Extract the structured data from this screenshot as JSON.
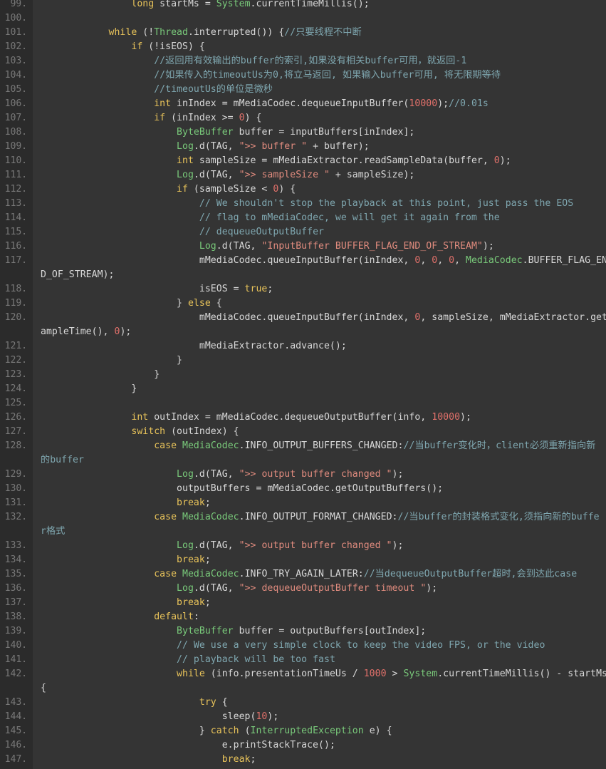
{
  "editor": {
    "name": "code-editor",
    "language": "Java",
    "wrap_enabled": true,
    "first_line": 99,
    "last_line": 147,
    "colors": {
      "background": "#343434",
      "gutter_background": "#2b2b2b",
      "line_number": "#787878",
      "plain": "#d8d8d8",
      "keyword": "#e8c35a",
      "type": "#79c97a",
      "string": "#e08b7e",
      "number": "#e0706a",
      "comment": "#7fa7b0"
    }
  },
  "lines": [
    {
      "no": "99.",
      "tokens": [
        {
          "t": "plain",
          "v": "                "
        },
        {
          "t": "kw",
          "v": "long"
        },
        {
          "t": "plain",
          "v": " startMs = "
        },
        {
          "t": "type",
          "v": "System"
        },
        {
          "t": "plain",
          "v": ".currentTimeMillis();"
        }
      ]
    },
    {
      "no": "100.",
      "tokens": []
    },
    {
      "no": "101.",
      "tokens": [
        {
          "t": "plain",
          "v": "            "
        },
        {
          "t": "kw",
          "v": "while"
        },
        {
          "t": "plain",
          "v": " (!"
        },
        {
          "t": "type",
          "v": "Thread"
        },
        {
          "t": "plain",
          "v": ".interrupted()) {"
        },
        {
          "t": "cmt",
          "v": "//只要线程不中断"
        }
      ]
    },
    {
      "no": "102.",
      "tokens": [
        {
          "t": "plain",
          "v": "                "
        },
        {
          "t": "kw",
          "v": "if"
        },
        {
          "t": "plain",
          "v": " (!isEOS) {"
        }
      ]
    },
    {
      "no": "103.",
      "tokens": [
        {
          "t": "plain",
          "v": "                    "
        },
        {
          "t": "cmt",
          "v": "//返回用有效输出的buffer的索引,如果没有相关buffer可用，就返回-1"
        }
      ]
    },
    {
      "no": "104.",
      "tokens": [
        {
          "t": "plain",
          "v": "                    "
        },
        {
          "t": "cmt",
          "v": "//如果传入的timeoutUs为0,将立马返回, 如果输入buffer可用, 将无限期等待"
        }
      ]
    },
    {
      "no": "105.",
      "tokens": [
        {
          "t": "plain",
          "v": "                    "
        },
        {
          "t": "cmt",
          "v": "//timeoutUs的单位是微秒"
        }
      ]
    },
    {
      "no": "106.",
      "tokens": [
        {
          "t": "plain",
          "v": "                    "
        },
        {
          "t": "kw",
          "v": "int"
        },
        {
          "t": "plain",
          "v": " inIndex = mMediaCodec.dequeueInputBuffer("
        },
        {
          "t": "num",
          "v": "10000"
        },
        {
          "t": "plain",
          "v": ");"
        },
        {
          "t": "cmt",
          "v": "//0.01s"
        }
      ]
    },
    {
      "no": "107.",
      "tokens": [
        {
          "t": "plain",
          "v": "                    "
        },
        {
          "t": "kw",
          "v": "if"
        },
        {
          "t": "plain",
          "v": " (inIndex >= "
        },
        {
          "t": "num",
          "v": "0"
        },
        {
          "t": "plain",
          "v": ") {"
        }
      ]
    },
    {
      "no": "108.",
      "tokens": [
        {
          "t": "plain",
          "v": "                        "
        },
        {
          "t": "type",
          "v": "ByteBuffer"
        },
        {
          "t": "plain",
          "v": " buffer = inputBuffers[inIndex];"
        }
      ]
    },
    {
      "no": "109.",
      "tokens": [
        {
          "t": "plain",
          "v": "                        "
        },
        {
          "t": "type",
          "v": "Log"
        },
        {
          "t": "plain",
          "v": ".d(TAG, "
        },
        {
          "t": "str",
          "v": "\">> buffer \""
        },
        {
          "t": "plain",
          "v": " + buffer);"
        }
      ]
    },
    {
      "no": "110.",
      "tokens": [
        {
          "t": "plain",
          "v": "                        "
        },
        {
          "t": "kw",
          "v": "int"
        },
        {
          "t": "plain",
          "v": " sampleSize = mMediaExtractor.readSampleData(buffer, "
        },
        {
          "t": "num",
          "v": "0"
        },
        {
          "t": "plain",
          "v": ");"
        }
      ]
    },
    {
      "no": "111.",
      "tokens": [
        {
          "t": "plain",
          "v": "                        "
        },
        {
          "t": "type",
          "v": "Log"
        },
        {
          "t": "plain",
          "v": ".d(TAG, "
        },
        {
          "t": "str",
          "v": "\">> sampleSize \""
        },
        {
          "t": "plain",
          "v": " + sampleSize);"
        }
      ]
    },
    {
      "no": "112.",
      "tokens": [
        {
          "t": "plain",
          "v": "                        "
        },
        {
          "t": "kw",
          "v": "if"
        },
        {
          "t": "plain",
          "v": " (sampleSize < "
        },
        {
          "t": "num",
          "v": "0"
        },
        {
          "t": "plain",
          "v": ") {"
        }
      ]
    },
    {
      "no": "113.",
      "tokens": [
        {
          "t": "plain",
          "v": "                            "
        },
        {
          "t": "cmt",
          "v": "// We shouldn't stop the playback at this point, just pass the EOS"
        }
      ]
    },
    {
      "no": "114.",
      "tokens": [
        {
          "t": "plain",
          "v": "                            "
        },
        {
          "t": "cmt",
          "v": "// flag to mMediaCodec, we will get it again from the"
        }
      ]
    },
    {
      "no": "115.",
      "tokens": [
        {
          "t": "plain",
          "v": "                            "
        },
        {
          "t": "cmt",
          "v": "// dequeueOutputBuffer"
        }
      ]
    },
    {
      "no": "116.",
      "tokens": [
        {
          "t": "plain",
          "v": "                            "
        },
        {
          "t": "type",
          "v": "Log"
        },
        {
          "t": "plain",
          "v": ".d(TAG, "
        },
        {
          "t": "str",
          "v": "\"InputBuffer BUFFER_FLAG_END_OF_STREAM\""
        },
        {
          "t": "plain",
          "v": ");"
        }
      ]
    },
    {
      "no": "117.",
      "tokens": [
        {
          "t": "plain",
          "v": "                            mMediaCodec.queueInputBuffer(inIndex, "
        },
        {
          "t": "num",
          "v": "0"
        },
        {
          "t": "plain",
          "v": ", "
        },
        {
          "t": "num",
          "v": "0"
        },
        {
          "t": "plain",
          "v": ", "
        },
        {
          "t": "num",
          "v": "0"
        },
        {
          "t": "plain",
          "v": ", "
        },
        {
          "t": "type",
          "v": "MediaCodec"
        },
        {
          "t": "plain",
          "v": ".BUFFER_FLAG_EN"
        }
      ]
    },
    {
      "no": "",
      "cont": true,
      "tokens": [
        {
          "t": "plain",
          "v": "D_OF_STREAM);"
        }
      ]
    },
    {
      "no": "118.",
      "tokens": [
        {
          "t": "plain",
          "v": "                            isEOS = "
        },
        {
          "t": "kw",
          "v": "true"
        },
        {
          "t": "plain",
          "v": ";"
        }
      ]
    },
    {
      "no": "119.",
      "tokens": [
        {
          "t": "plain",
          "v": "                        } "
        },
        {
          "t": "kw",
          "v": "else"
        },
        {
          "t": "plain",
          "v": " {"
        }
      ]
    },
    {
      "no": "120.",
      "tokens": [
        {
          "t": "plain",
          "v": "                            mMediaCodec.queueInputBuffer(inIndex, "
        },
        {
          "t": "num",
          "v": "0"
        },
        {
          "t": "plain",
          "v": ", sampleSize, mMediaExtractor.getS"
        }
      ]
    },
    {
      "no": "",
      "cont": true,
      "tokens": [
        {
          "t": "plain",
          "v": "ampleTime(), "
        },
        {
          "t": "num",
          "v": "0"
        },
        {
          "t": "plain",
          "v": ");"
        }
      ]
    },
    {
      "no": "121.",
      "tokens": [
        {
          "t": "plain",
          "v": "                            mMediaExtractor.advance();"
        }
      ]
    },
    {
      "no": "122.",
      "tokens": [
        {
          "t": "plain",
          "v": "                        }"
        }
      ]
    },
    {
      "no": "123.",
      "tokens": [
        {
          "t": "plain",
          "v": "                    }"
        }
      ]
    },
    {
      "no": "124.",
      "tokens": [
        {
          "t": "plain",
          "v": "                }"
        }
      ]
    },
    {
      "no": "125.",
      "tokens": []
    },
    {
      "no": "126.",
      "tokens": [
        {
          "t": "plain",
          "v": "                "
        },
        {
          "t": "kw",
          "v": "int"
        },
        {
          "t": "plain",
          "v": " outIndex = mMediaCodec.dequeueOutputBuffer(info, "
        },
        {
          "t": "num",
          "v": "10000"
        },
        {
          "t": "plain",
          "v": ");"
        }
      ]
    },
    {
      "no": "127.",
      "tokens": [
        {
          "t": "plain",
          "v": "                "
        },
        {
          "t": "kw",
          "v": "switch"
        },
        {
          "t": "plain",
          "v": " (outIndex) {"
        }
      ]
    },
    {
      "no": "128.",
      "tokens": [
        {
          "t": "plain",
          "v": "                    "
        },
        {
          "t": "kw",
          "v": "case"
        },
        {
          "t": "plain",
          "v": " "
        },
        {
          "t": "type",
          "v": "MediaCodec"
        },
        {
          "t": "plain",
          "v": ".INFO_OUTPUT_BUFFERS_CHANGED:"
        },
        {
          "t": "cmt",
          "v": "//当buffer变化时，client必须重新指向新"
        }
      ]
    },
    {
      "no": "",
      "cont": true,
      "tokens": [
        {
          "t": "cmt",
          "v": "的buffer"
        }
      ]
    },
    {
      "no": "129.",
      "tokens": [
        {
          "t": "plain",
          "v": "                        "
        },
        {
          "t": "type",
          "v": "Log"
        },
        {
          "t": "plain",
          "v": ".d(TAG, "
        },
        {
          "t": "str",
          "v": "\">> output buffer changed \""
        },
        {
          "t": "plain",
          "v": ");"
        }
      ]
    },
    {
      "no": "130.",
      "tokens": [
        {
          "t": "plain",
          "v": "                        outputBuffers = mMediaCodec.getOutputBuffers();"
        }
      ]
    },
    {
      "no": "131.",
      "tokens": [
        {
          "t": "plain",
          "v": "                        "
        },
        {
          "t": "kw",
          "v": "break"
        },
        {
          "t": "plain",
          "v": ";"
        }
      ]
    },
    {
      "no": "132.",
      "tokens": [
        {
          "t": "plain",
          "v": "                    "
        },
        {
          "t": "kw",
          "v": "case"
        },
        {
          "t": "plain",
          "v": " "
        },
        {
          "t": "type",
          "v": "MediaCodec"
        },
        {
          "t": "plain",
          "v": ".INFO_OUTPUT_FORMAT_CHANGED:"
        },
        {
          "t": "cmt",
          "v": "//当buffer的封装格式变化,须指向新的buffe"
        }
      ]
    },
    {
      "no": "",
      "cont": true,
      "tokens": [
        {
          "t": "cmt",
          "v": "r格式"
        }
      ]
    },
    {
      "no": "133.",
      "tokens": [
        {
          "t": "plain",
          "v": "                        "
        },
        {
          "t": "type",
          "v": "Log"
        },
        {
          "t": "plain",
          "v": ".d(TAG, "
        },
        {
          "t": "str",
          "v": "\">> output buffer changed \""
        },
        {
          "t": "plain",
          "v": ");"
        }
      ]
    },
    {
      "no": "134.",
      "tokens": [
        {
          "t": "plain",
          "v": "                        "
        },
        {
          "t": "kw",
          "v": "break"
        },
        {
          "t": "plain",
          "v": ";"
        }
      ]
    },
    {
      "no": "135.",
      "tokens": [
        {
          "t": "plain",
          "v": "                    "
        },
        {
          "t": "kw",
          "v": "case"
        },
        {
          "t": "plain",
          "v": " "
        },
        {
          "t": "type",
          "v": "MediaCodec"
        },
        {
          "t": "plain",
          "v": ".INFO_TRY_AGAIN_LATER:"
        },
        {
          "t": "cmt",
          "v": "//当dequeueOutputBuffer超时,会到达此case"
        }
      ]
    },
    {
      "no": "136.",
      "tokens": [
        {
          "t": "plain",
          "v": "                        "
        },
        {
          "t": "type",
          "v": "Log"
        },
        {
          "t": "plain",
          "v": ".d(TAG, "
        },
        {
          "t": "str",
          "v": "\">> dequeueOutputBuffer timeout \""
        },
        {
          "t": "plain",
          "v": ");"
        }
      ]
    },
    {
      "no": "137.",
      "tokens": [
        {
          "t": "plain",
          "v": "                        "
        },
        {
          "t": "kw",
          "v": "break"
        },
        {
          "t": "plain",
          "v": ";"
        }
      ]
    },
    {
      "no": "138.",
      "tokens": [
        {
          "t": "plain",
          "v": "                    "
        },
        {
          "t": "kw",
          "v": "default"
        },
        {
          "t": "plain",
          "v": ":"
        }
      ]
    },
    {
      "no": "139.",
      "tokens": [
        {
          "t": "plain",
          "v": "                        "
        },
        {
          "t": "type",
          "v": "ByteBuffer"
        },
        {
          "t": "plain",
          "v": " buffer = outputBuffers[outIndex];"
        }
      ]
    },
    {
      "no": "140.",
      "tokens": [
        {
          "t": "plain",
          "v": "                        "
        },
        {
          "t": "cmt",
          "v": "// We use a very simple clock to keep the video FPS, or the video"
        }
      ]
    },
    {
      "no": "141.",
      "tokens": [
        {
          "t": "plain",
          "v": "                        "
        },
        {
          "t": "cmt",
          "v": "// playback will be too fast"
        }
      ]
    },
    {
      "no": "142.",
      "tokens": [
        {
          "t": "plain",
          "v": "                        "
        },
        {
          "t": "kw",
          "v": "while"
        },
        {
          "t": "plain",
          "v": " (info.presentationTimeUs / "
        },
        {
          "t": "num",
          "v": "1000"
        },
        {
          "t": "plain",
          "v": " > "
        },
        {
          "t": "type",
          "v": "System"
        },
        {
          "t": "plain",
          "v": ".currentTimeMillis() - startMs)"
        }
      ]
    },
    {
      "no": "",
      "cont": true,
      "tokens": [
        {
          "t": "plain",
          "v": "{"
        }
      ]
    },
    {
      "no": "143.",
      "tokens": [
        {
          "t": "plain",
          "v": "                            "
        },
        {
          "t": "kw",
          "v": "try"
        },
        {
          "t": "plain",
          "v": " {"
        }
      ]
    },
    {
      "no": "144.",
      "tokens": [
        {
          "t": "plain",
          "v": "                                sleep("
        },
        {
          "t": "num",
          "v": "10"
        },
        {
          "t": "plain",
          "v": ");"
        }
      ]
    },
    {
      "no": "145.",
      "tokens": [
        {
          "t": "plain",
          "v": "                            } "
        },
        {
          "t": "kw",
          "v": "catch"
        },
        {
          "t": "plain",
          "v": " ("
        },
        {
          "t": "type",
          "v": "InterruptedException"
        },
        {
          "t": "plain",
          "v": " e) {"
        }
      ]
    },
    {
      "no": "146.",
      "tokens": [
        {
          "t": "plain",
          "v": "                                e.printStackTrace();"
        }
      ]
    },
    {
      "no": "147.",
      "tokens": [
        {
          "t": "plain",
          "v": "                                "
        },
        {
          "t": "kw",
          "v": "break"
        },
        {
          "t": "plain",
          "v": ";"
        }
      ]
    }
  ]
}
